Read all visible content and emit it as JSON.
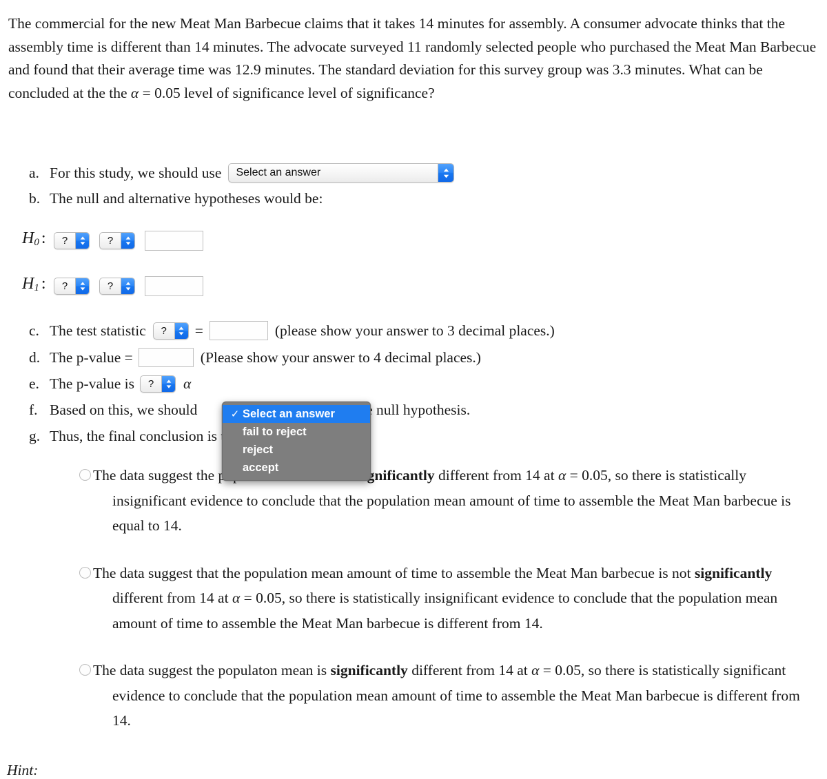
{
  "problem": {
    "text_parts": [
      "The commercial for the new Meat Man Barbecue claims that it takes 14 minutes for assembly. A consumer advocate thinks that the assembly time is different than 14 minutes. The advocate surveyed 11 randomly selected people who purchased the Meat Man Barbecue and found that their average time was 12.9 minutes. The standard deviation for this survey group was 3.3 minutes.  What can be concluded at the the ",
      "α",
      " = 0.05 level of significance level of significance?"
    ]
  },
  "items": {
    "a": {
      "marker": "a.",
      "text": "For this study, we should use",
      "select_value": "Select an answer"
    },
    "b": {
      "marker": "b.",
      "text": "The null and alternative hypotheses would be:",
      "h0_label": "H",
      "h0_sub": "0",
      "h1_label": "H",
      "h1_sub": "1",
      "colon": ":",
      "q_placeholder": "?",
      "input_value": ""
    },
    "c": {
      "marker": "c.",
      "text": "The test statistic",
      "q_placeholder": "?",
      "equals": "=",
      "input_value": "",
      "note": "(please show your answer to 3 decimal places.)"
    },
    "d": {
      "marker": "d.",
      "text": "The p-value =",
      "input_value": "",
      "note": "(Please show your answer to 4 decimal places.)"
    },
    "e": {
      "marker": "e.",
      "text": "The p-value is",
      "q_placeholder": "?",
      "alpha": "α"
    },
    "f": {
      "marker": "f.",
      "text": "Based on this, we should",
      "tail": "the null hypothesis."
    },
    "g": {
      "marker": "g.",
      "text": "Thus, the final conclusion is that ..."
    }
  },
  "dropdown": {
    "checkmark": "✓",
    "options": [
      {
        "label": "Select an answer",
        "selected": true
      },
      {
        "label": "fail to reject",
        "selected": false
      },
      {
        "label": "reject",
        "selected": false
      },
      {
        "label": "accept",
        "selected": false
      }
    ]
  },
  "choices": [
    {
      "id": "choice-1",
      "html": "The data suggest the population mean is not <b>significantly</b> different from 14 at <span class=\"mv\">α</span> = 0.05, so there is statistically insignificant evidence to conclude that the population mean amount of time to assemble the Meat Man barbecue is equal to 14."
    },
    {
      "id": "choice-2",
      "html": "The data suggest that the population mean amount of time to assemble the Meat Man barbecue is not <b>significantly</b> different from 14 at <span class=\"mv\">α</span> = 0.05, so there is statistically insignificant evidence to conclude that the population mean amount of time to assemble the Meat Man barbecue is different from 14."
    },
    {
      "id": "choice-3",
      "html": "The data suggest the populaton mean is <b>significantly</b> different from 14 at <span class=\"mv\">α</span> = 0.05, so there is statistically significant evidence to conclude that the population mean amount of time to assemble the Meat Man barbecue is different from 14."
    }
  ],
  "hint": {
    "label": "Hint:"
  },
  "colors": {
    "accent_blue": "#1f7df0",
    "select_arrow_blue": "#2b86f7",
    "menu_gray": "#7e7e7e",
    "input_border": "#bfbfbf",
    "text": "#1a1a1a"
  }
}
